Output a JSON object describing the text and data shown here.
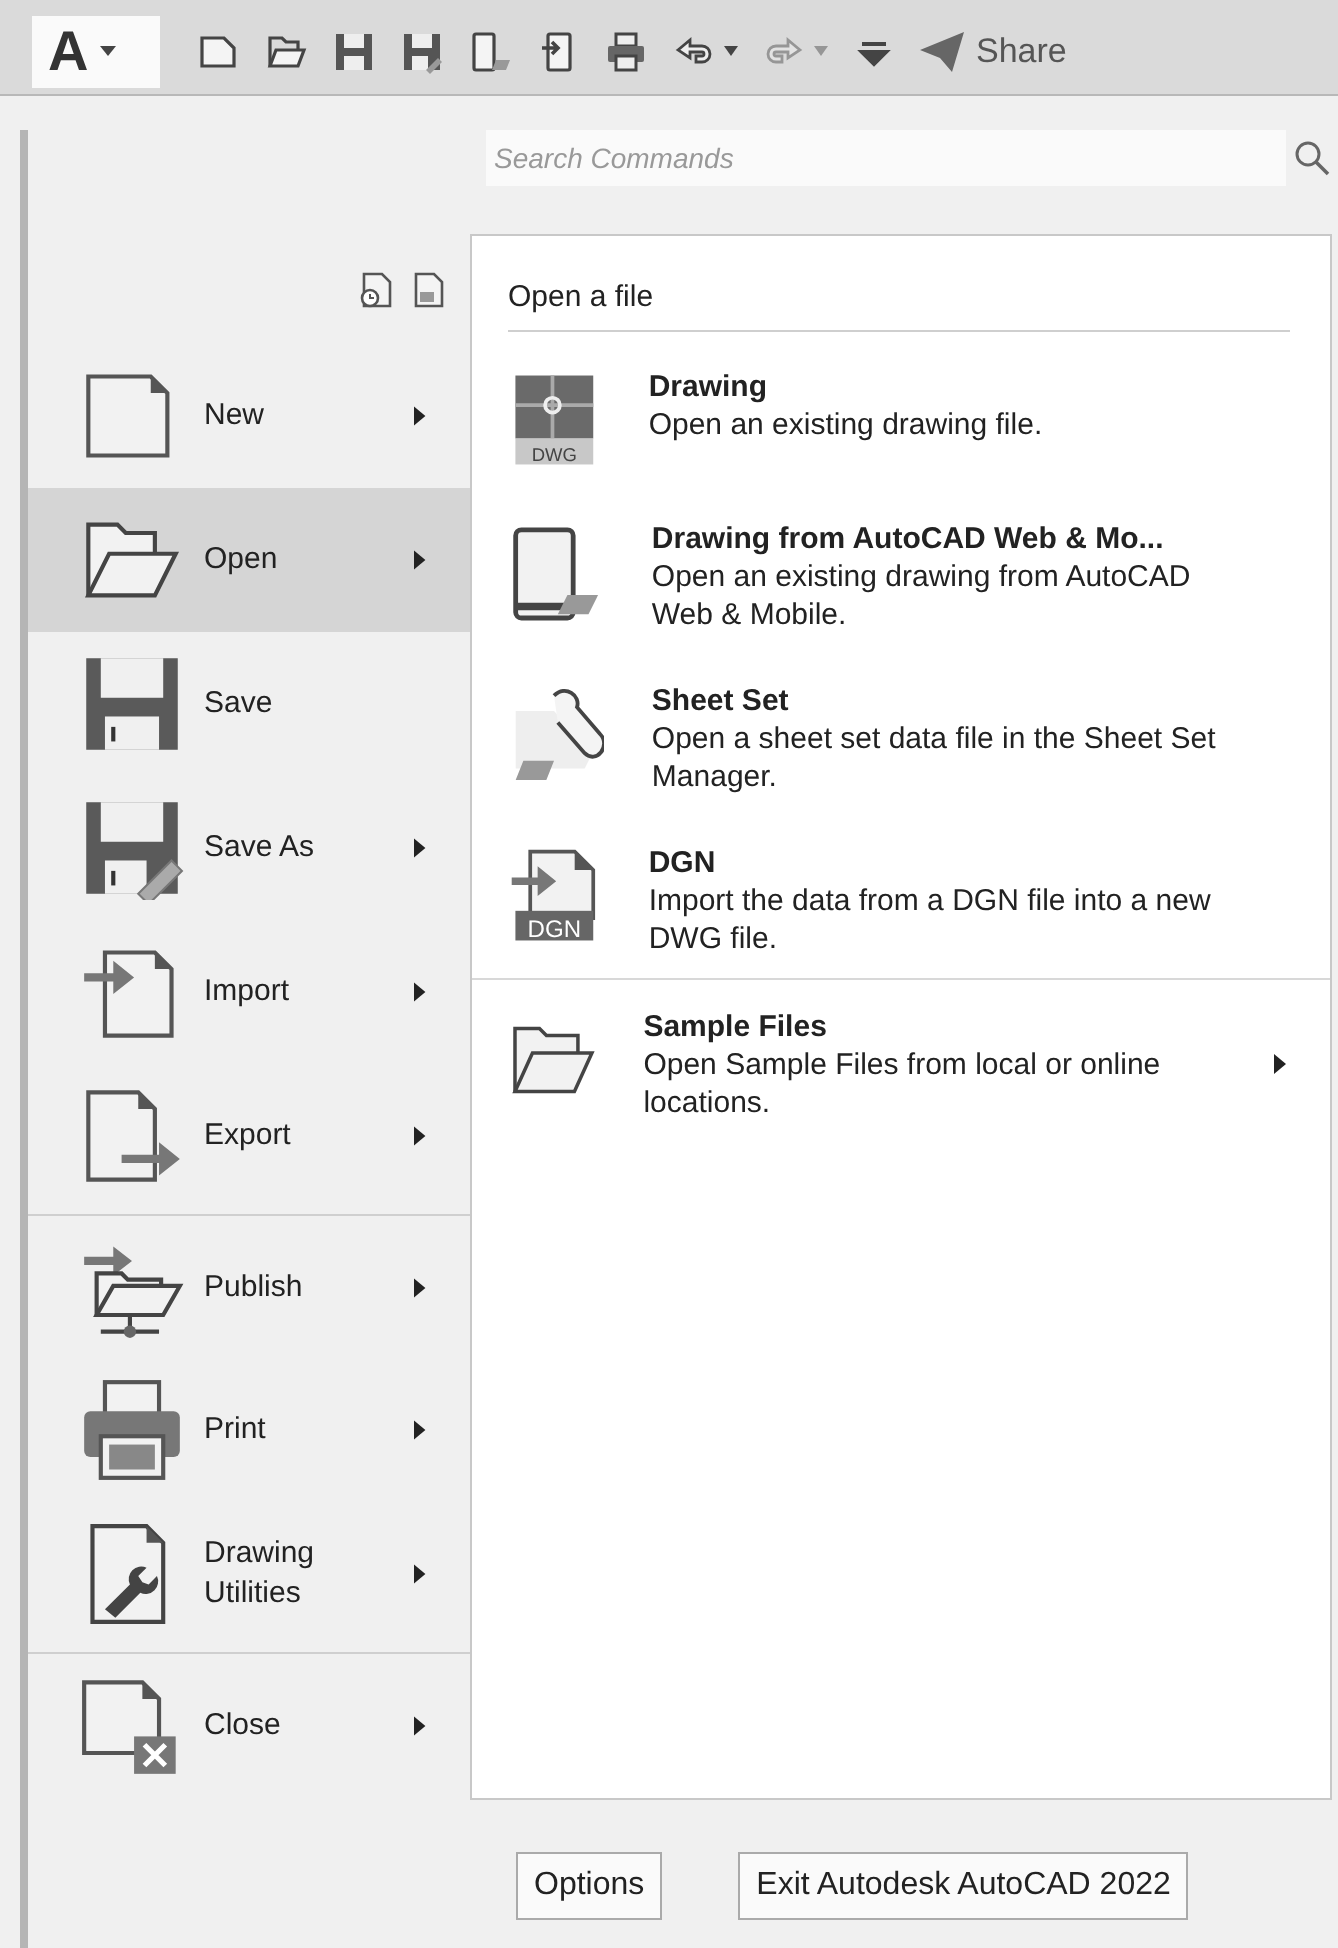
{
  "quick_access_toolbar": {
    "app_button": {
      "label": "A"
    },
    "tools": [
      {
        "kind": "new",
        "dropdown": false,
        "disabled": false
      },
      {
        "kind": "open",
        "dropdown": false,
        "disabled": false
      },
      {
        "kind": "save",
        "dropdown": false,
        "disabled": false
      },
      {
        "kind": "save_as",
        "dropdown": false,
        "disabled": false
      },
      {
        "kind": "open_web",
        "dropdown": false,
        "disabled": false
      },
      {
        "kind": "save_web",
        "dropdown": false,
        "disabled": false
      },
      {
        "kind": "plot",
        "dropdown": false,
        "disabled": false
      },
      {
        "kind": "undo",
        "dropdown": true,
        "disabled": false
      },
      {
        "kind": "redo",
        "dropdown": true,
        "disabled": true
      },
      {
        "kind": "customize",
        "dropdown": false,
        "disabled": false
      }
    ],
    "share": {
      "label": "Share"
    }
  },
  "search": {
    "placeholder": "Search Commands"
  },
  "menu": {
    "items": [
      {
        "kind": "new",
        "label": "New",
        "submenu": true,
        "selected": false,
        "separator_before": false
      },
      {
        "kind": "open",
        "label": "Open",
        "submenu": true,
        "selected": true,
        "separator_before": false
      },
      {
        "kind": "save",
        "label": "Save",
        "submenu": false,
        "selected": false,
        "separator_before": false
      },
      {
        "kind": "save_as",
        "label": "Save As",
        "submenu": true,
        "selected": false,
        "separator_before": false
      },
      {
        "kind": "import",
        "label": "Import",
        "submenu": true,
        "selected": false,
        "separator_before": false
      },
      {
        "kind": "export",
        "label": "Export",
        "submenu": true,
        "selected": false,
        "separator_before": false
      },
      {
        "kind": "publish",
        "label": "Publish",
        "submenu": true,
        "selected": false,
        "separator_before": true
      },
      {
        "kind": "print",
        "label": "Print",
        "submenu": true,
        "selected": false,
        "separator_before": false
      },
      {
        "kind": "utilities",
        "label": "Drawing Utilities",
        "submenu": true,
        "selected": false,
        "separator_before": false
      },
      {
        "kind": "close",
        "label": "Close",
        "submenu": true,
        "selected": false,
        "separator_before": true
      }
    ]
  },
  "open_panel": {
    "title": "Open a file",
    "items": [
      {
        "kind": "dwg",
        "icon_text": "DWG",
        "title": "Drawing",
        "description": "Open an existing drawing file.",
        "submenu": false,
        "separator_before": false
      },
      {
        "kind": "web_mobile",
        "title": "Drawing from AutoCAD Web & Mo...",
        "description": "Open an existing drawing from AutoCAD Web & Mobile.",
        "submenu": false,
        "separator_before": false
      },
      {
        "kind": "sheet_set",
        "title": "Sheet Set",
        "description": "Open a sheet set data file in the Sheet Set Manager.",
        "submenu": false,
        "separator_before": false
      },
      {
        "kind": "dgn",
        "icon_text": "DGN",
        "title": "DGN",
        "description": "Import the data from a DGN file into a new DWG file.",
        "submenu": false,
        "separator_before": false
      },
      {
        "kind": "sample_folder",
        "title": "Sample Files",
        "description": "Open Sample Files from local or online locations.",
        "submenu": true,
        "separator_before": true
      }
    ]
  },
  "buttons": [
    "Options",
    "Exit Autodesk AutoCAD 2022"
  ]
}
